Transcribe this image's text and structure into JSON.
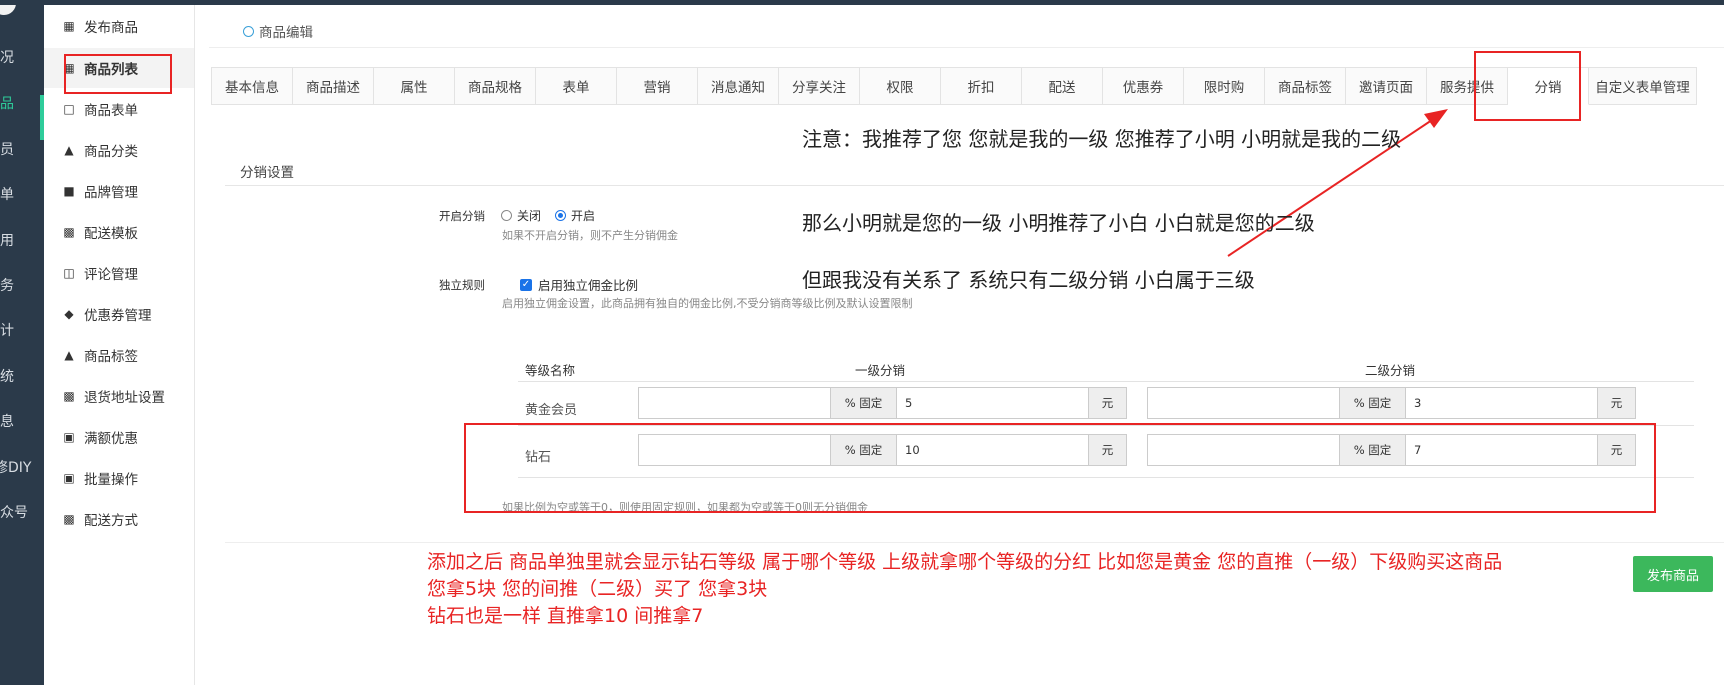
{
  "rail": {
    "items": [
      "况",
      "品",
      "员",
      "单",
      "用",
      "务",
      "计",
      "统",
      "息",
      "修DIY",
      "众号"
    ]
  },
  "sidebar": {
    "items": [
      {
        "label": "发布商品",
        "icon": "cubes-icon"
      },
      {
        "label": "商品列表",
        "icon": "cubes-icon"
      },
      {
        "label": "商品表单",
        "icon": "file-icon"
      },
      {
        "label": "商品分类",
        "icon": "sitemap-icon"
      },
      {
        "label": "品牌管理",
        "icon": "briefcase-icon"
      },
      {
        "label": "配送模板",
        "icon": "truck-icon"
      },
      {
        "label": "评论管理",
        "icon": "columns-icon"
      },
      {
        "label": "优惠券管理",
        "icon": "tags-icon"
      },
      {
        "label": "商品标签",
        "icon": "sitemap-icon"
      },
      {
        "label": "退货地址设置",
        "icon": "truck-icon"
      },
      {
        "label": "满额优惠",
        "icon": "gift-icon"
      },
      {
        "label": "批量操作",
        "icon": "gift-icon"
      },
      {
        "label": "配送方式",
        "icon": "truck-icon"
      }
    ]
  },
  "breadcrumb": "商品编辑",
  "tabs": [
    "基本信息",
    "商品描述",
    "属性",
    "商品规格",
    "表单",
    "营销",
    "消息通知",
    "分享关注",
    "权限",
    "折扣",
    "配送",
    "优惠券",
    "限时购",
    "商品标签",
    "邀请页面",
    "服务提供",
    "分销",
    "自定义表单管理"
  ],
  "active_tab": "分销",
  "section_title": "分销设置",
  "form": {
    "enable_label": "开启分销",
    "radio_off": "关闭",
    "radio_on": "开启",
    "enable_hint": "如果不开启分销，则不产生分销佣金",
    "rule_label": "独立规则",
    "rule_checkbox": "启用独立佣金比例",
    "rule_hint": "启用独立佣金设置，此商品拥有独自的佣金比例,不受分销商等级比例及默认设置限制"
  },
  "table": {
    "headers": [
      "等级名称",
      "一级分销",
      "二级分销"
    ],
    "rows": [
      {
        "level": "黄金会员",
        "l1_pct": "",
        "l1_fixed": "5",
        "l2_pct": "",
        "l2_fixed": "3"
      },
      {
        "level": "钻石",
        "l1_pct": "",
        "l1_fixed": "10",
        "l2_pct": "",
        "l2_fixed": "7"
      }
    ],
    "addon_pct": "% 固定",
    "addon_unit": "元",
    "footer_hint": "如果比例为空或等于0，则使用固定规则，如果都为空或等于0则无分销佣金"
  },
  "notes": {
    "line1": "注意：我推荐了您  您就是我的一级   您推荐了小明  小明就是我的二级",
    "line2": "那么小明就是您的一级    小明推荐了小白   小白就是您的二级",
    "line3": "但跟我没有关系了  系统只有二级分销   小白属于三级"
  },
  "red_notes": {
    "line1": "添加之后  商品单独里就会显示钻石等级    属于哪个等级 上级就拿哪个等级的分红  比如您是黄金 您的直推（一级）下级购买这商品",
    "line2": "您拿5块  您的间推（二级）买了 您拿3块",
    "line3": "钻石也是一样  直推拿10  间推拿7"
  },
  "publish_button": "发布商品",
  "colors": {
    "rail_bg": "#2b3a4a",
    "accent_green": "#2ecc9a",
    "annotation_red": "#e82424",
    "button_green": "#3cb85c",
    "radio_blue": "#1a73e8"
  }
}
